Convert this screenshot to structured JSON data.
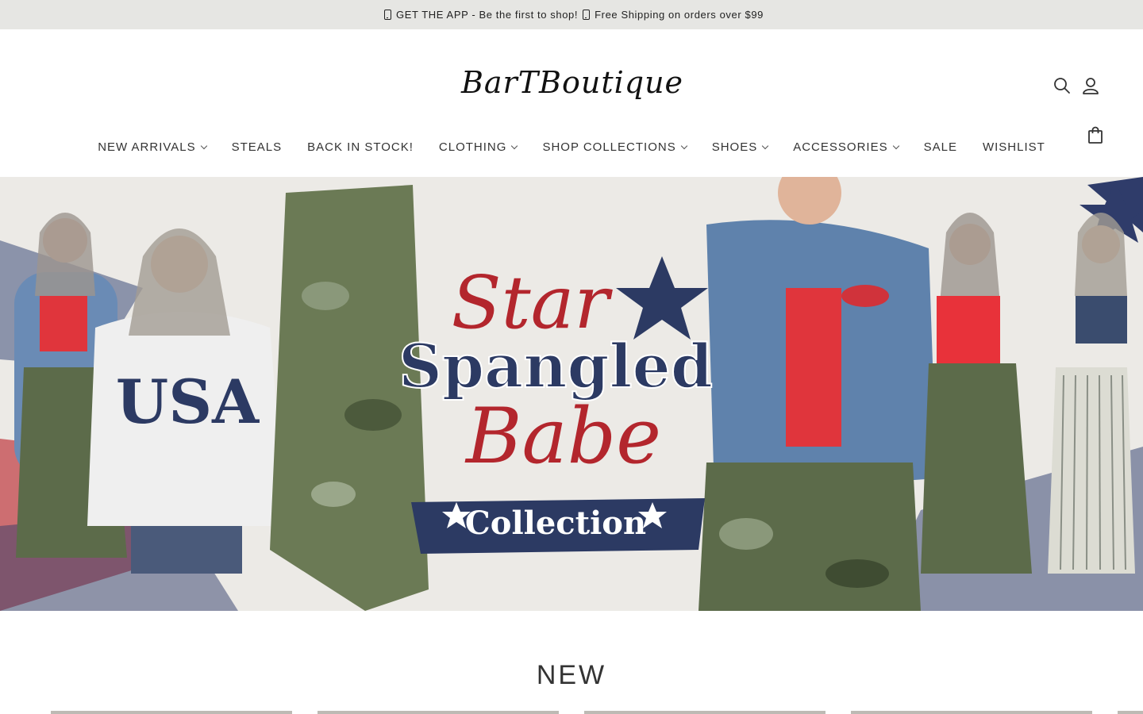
{
  "announcement": {
    "part1": "GET THE APP - Be the first to shop!",
    "part2": "Free Shipping on orders over $99"
  },
  "header": {
    "logo_text": "BarTBoutique",
    "icons": [
      "search-icon",
      "account-icon",
      "shopping-bag-icon"
    ]
  },
  "nav": {
    "items": [
      {
        "label": "NEW ARRIVALS",
        "dropdown": true
      },
      {
        "label": "STEALS",
        "dropdown": false
      },
      {
        "label": "BACK IN STOCK!",
        "dropdown": false
      },
      {
        "label": "CLOTHING",
        "dropdown": true
      },
      {
        "label": "SHOP COLLECTIONS",
        "dropdown": true
      },
      {
        "label": "SHOES",
        "dropdown": true
      },
      {
        "label": "ACCESSORIES",
        "dropdown": true
      },
      {
        "label": "SALE",
        "dropdown": false
      },
      {
        "label": "WISHLIST",
        "dropdown": false
      }
    ]
  },
  "hero": {
    "line1": "Star",
    "line2": "Spangled",
    "line3": "Babe",
    "banner": "Collection",
    "sweatshirt_text": "USA"
  },
  "section": {
    "title": "NEW"
  },
  "colors": {
    "announcement_bg": "#e6e6e3",
    "navy": "#2c3a63",
    "red": "#b3262d",
    "text": "#333333"
  }
}
